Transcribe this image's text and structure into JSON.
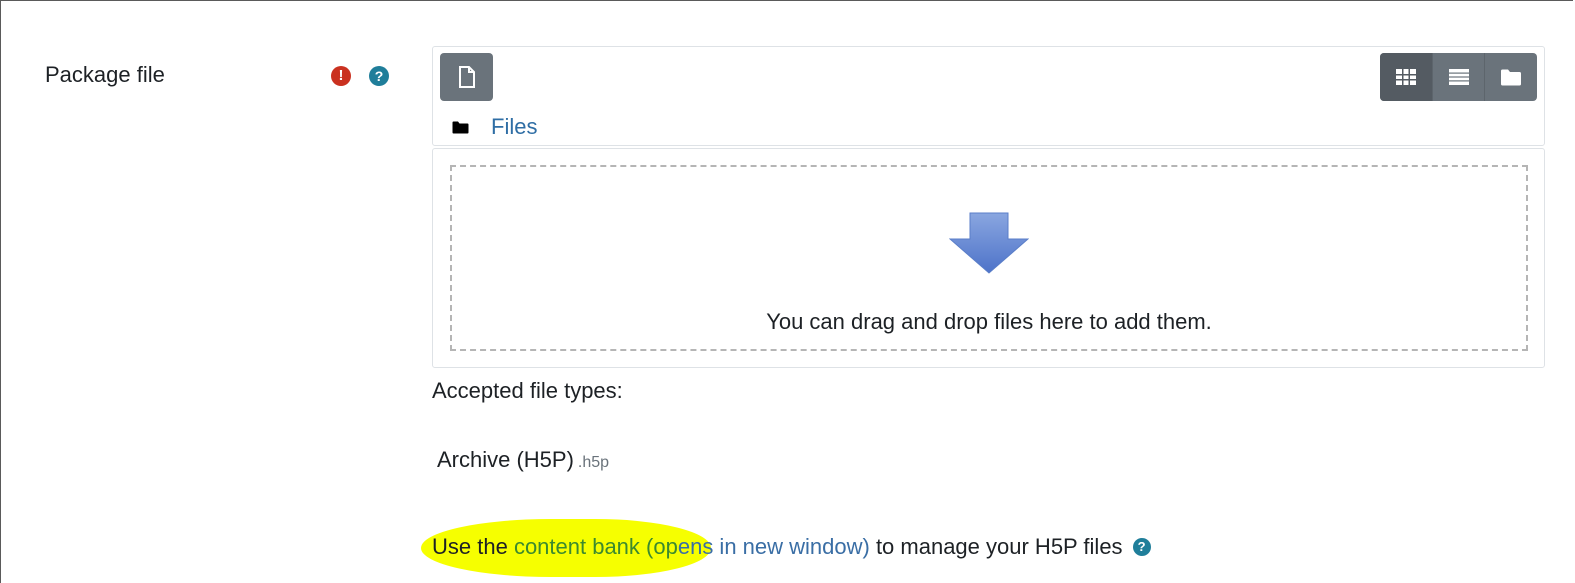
{
  "field": {
    "label": "Package file",
    "required_icon": "exclamation-circle-icon",
    "help_icon": "question-circle-icon"
  },
  "filemanager": {
    "add_icon": "file-icon",
    "view_buttons": [
      {
        "name": "icons-view",
        "icon": "grid-icon"
      },
      {
        "name": "list-view",
        "icon": "list-icon"
      },
      {
        "name": "tree-view",
        "icon": "folder-icon"
      }
    ],
    "path_label": "Files",
    "drop_text": "You can drag and drop files here to add them."
  },
  "accepted": {
    "heading": "Accepted file types:",
    "type_name": "Archive (H5P)",
    "type_ext": ".h5p"
  },
  "contentbank": {
    "prefix": "Use the ",
    "link_part1": "content bank (op",
    "link_part2": "ens in new window)",
    "suffix": " to manage your H5P files"
  },
  "colors": {
    "required": "#ca3120",
    "help": "#1f7e9a",
    "link": "#2f6ea5",
    "highlight": "#f6ff00",
    "button": "#6a737b"
  }
}
